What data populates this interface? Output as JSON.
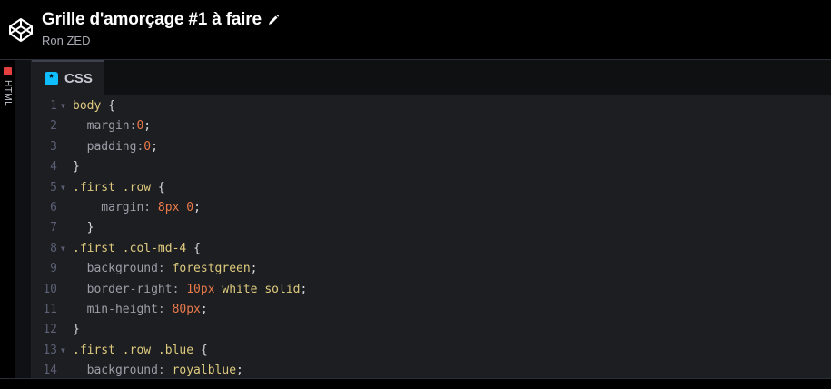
{
  "header": {
    "title": "Grille d'amorçage #1 à faire",
    "author": "Ron ZED"
  },
  "sidebar": {
    "collapsed_panel_label": "HTML"
  },
  "editor": {
    "tab_icon_glyph": "*",
    "tab_label": "CSS",
    "lines": [
      {
        "n": "1",
        "fold": true,
        "tokens": [
          [
            "sel",
            "body "
          ],
          [
            "brace",
            "{"
          ]
        ]
      },
      {
        "n": "2",
        "fold": false,
        "tokens": [
          [
            "prop",
            "  margin:"
          ],
          [
            "num",
            "0"
          ],
          [
            "brace",
            ";"
          ]
        ]
      },
      {
        "n": "3",
        "fold": false,
        "tokens": [
          [
            "prop",
            "  padding:"
          ],
          [
            "num",
            "0"
          ],
          [
            "brace",
            ";"
          ]
        ]
      },
      {
        "n": "4",
        "fold": false,
        "tokens": [
          [
            "brace",
            "}"
          ]
        ]
      },
      {
        "n": "5",
        "fold": true,
        "tokens": [
          [
            "sel",
            ".first .row "
          ],
          [
            "brace",
            "{"
          ]
        ]
      },
      {
        "n": "6",
        "fold": false,
        "tokens": [
          [
            "prop",
            "    margin: "
          ],
          [
            "num",
            "8px 0"
          ],
          [
            "brace",
            ";"
          ]
        ]
      },
      {
        "n": "7",
        "fold": false,
        "tokens": [
          [
            "brace",
            "  }"
          ]
        ]
      },
      {
        "n": "8",
        "fold": true,
        "tokens": [
          [
            "sel",
            ".first .col-md-4 "
          ],
          [
            "brace",
            "{"
          ]
        ]
      },
      {
        "n": "9",
        "fold": false,
        "tokens": [
          [
            "prop",
            "  background: "
          ],
          [
            "val",
            "forestgreen"
          ],
          [
            "brace",
            ";"
          ]
        ]
      },
      {
        "n": "10",
        "fold": false,
        "tokens": [
          [
            "prop",
            "  border-right: "
          ],
          [
            "num",
            "10px "
          ],
          [
            "val",
            "white solid"
          ],
          [
            "brace",
            ";"
          ]
        ]
      },
      {
        "n": "11",
        "fold": false,
        "tokens": [
          [
            "prop",
            "  min-height: "
          ],
          [
            "num",
            "80px"
          ],
          [
            "brace",
            ";"
          ]
        ]
      },
      {
        "n": "12",
        "fold": false,
        "tokens": [
          [
            "brace",
            "}"
          ]
        ]
      },
      {
        "n": "13",
        "fold": true,
        "tokens": [
          [
            "sel",
            ".first .row .blue "
          ],
          [
            "brace",
            "{"
          ]
        ]
      },
      {
        "n": "14",
        "fold": false,
        "tokens": [
          [
            "prop",
            "  background: "
          ],
          [
            "val",
            "royalblue"
          ],
          [
            "brace",
            ";"
          ]
        ]
      }
    ]
  },
  "colors": {
    "tab_icon": "#0ebeff",
    "html_badge": "#e53e3e",
    "editor_bg": "#1d1e22"
  }
}
